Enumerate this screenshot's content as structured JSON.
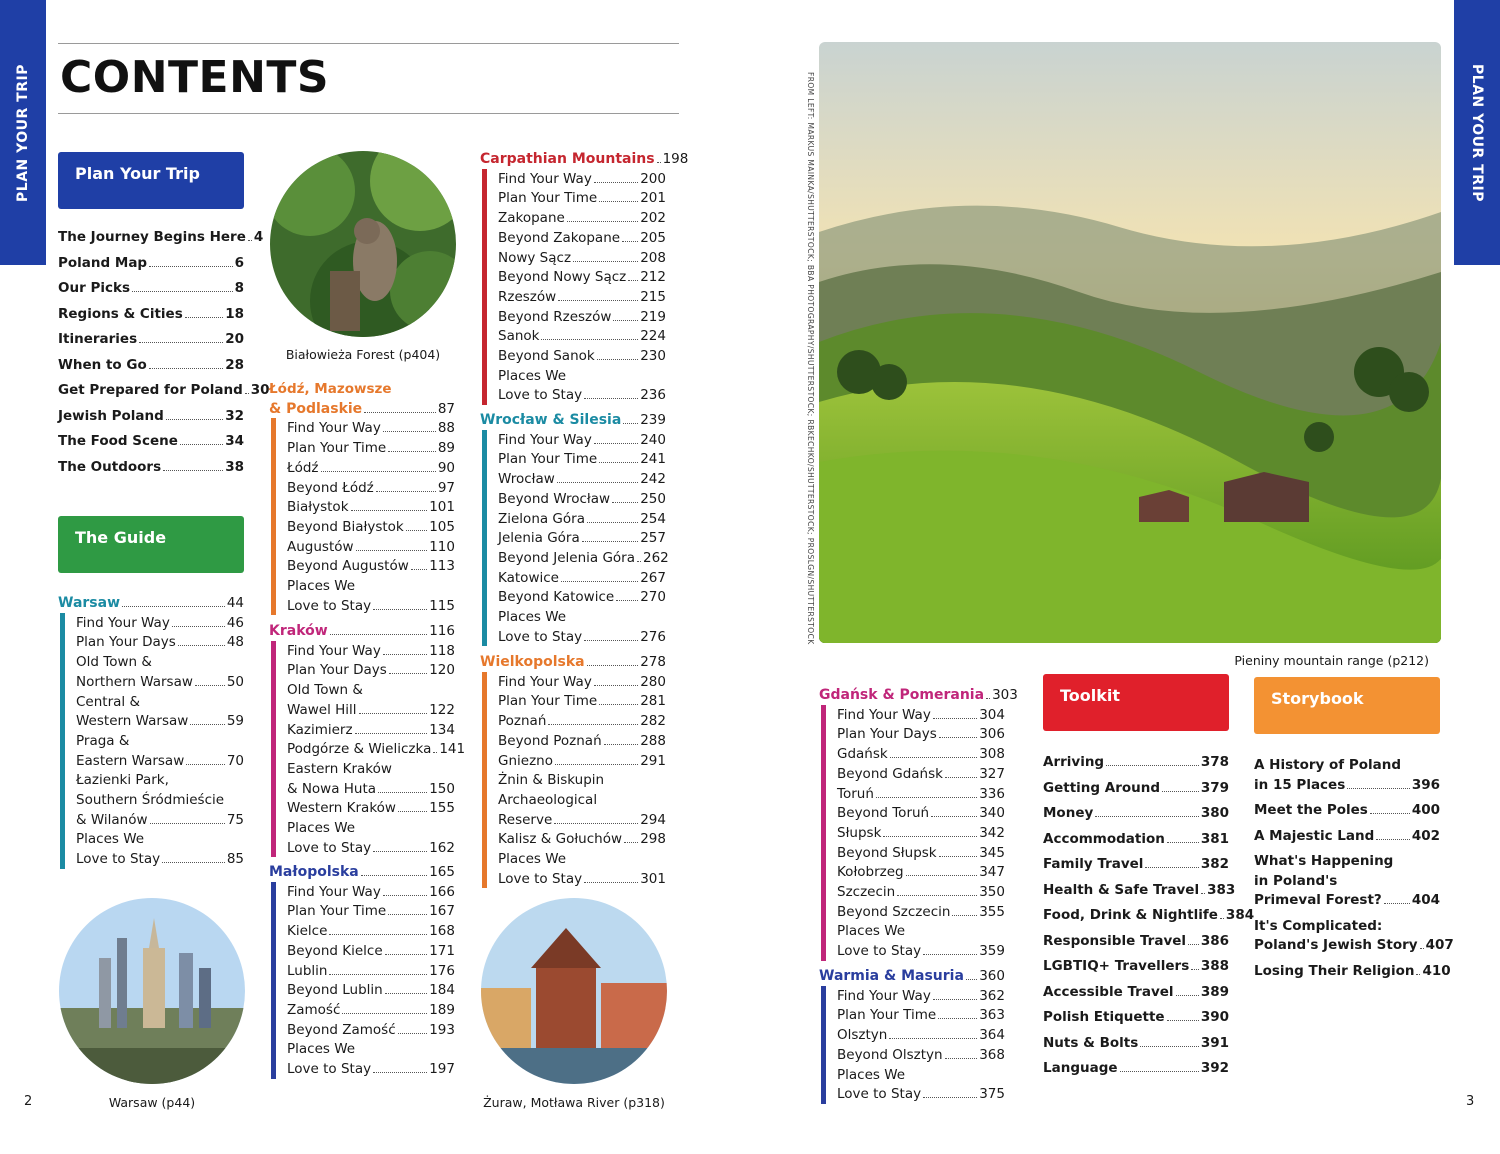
{
  "side_tabs": {
    "left": "PLAN YOUR TRIP",
    "right": "PLAN YOUR TRIP"
  },
  "title": "CONTENTS",
  "boxes": {
    "plan": "Plan Your Trip",
    "guide": "The Guide",
    "toolkit": "Toolkit",
    "storybook": "Storybook"
  },
  "colors": {
    "blue": "#1f3fa6",
    "green": "#2f9a44",
    "red": "#e0202b",
    "orange": "#f39233",
    "warsaw": "#1b8ba3",
    "lodz": "#e6782c",
    "krakow": "#c0267a",
    "malopolska": "#2a3e9e",
    "carpathian": "#c5262f",
    "wroclaw": "#1b8ba3",
    "wielkopolska": "#e6782c",
    "gdansk": "#c0267a",
    "warmia": "#2a3e9e"
  },
  "plan_trip": [
    {
      "t": "The Journey Begins Here",
      "p": "4"
    },
    {
      "t": "Poland Map",
      "p": "6"
    },
    {
      "t": "Our Picks",
      "p": "8"
    },
    {
      "t": "Regions & Cities",
      "p": "18"
    },
    {
      "t": "Itineraries",
      "p": "20"
    },
    {
      "t": "When to Go",
      "p": "28"
    },
    {
      "t": "Get Prepared for Poland",
      "p": "30"
    },
    {
      "t": "Jewish Poland",
      "p": "32"
    },
    {
      "t": "The Food Scene",
      "p": "34"
    },
    {
      "t": "The Outdoors",
      "p": "38"
    }
  ],
  "warsaw": {
    "title": "Warsaw",
    "page": "44",
    "items": [
      {
        "t": "Find Your Way",
        "p": "46"
      },
      {
        "t": "Plan Your Days",
        "p": "48"
      },
      {
        "pre": "Old Town &",
        "t": "Northern Warsaw",
        "p": "50"
      },
      {
        "pre": "Central &",
        "t": "Western Warsaw",
        "p": "59"
      },
      {
        "pre": "Praga &",
        "t": "Eastern Warsaw",
        "p": "70"
      },
      {
        "pre": "Łazienki Park,",
        "pre2": "Southern Śródmieście",
        "t": "& Wilanów",
        "p": "75"
      },
      {
        "pre": "Places We",
        "t": "Love to Stay",
        "p": "85"
      }
    ]
  },
  "lodz": {
    "title1": "Łódź, Mazowsze",
    "title": "& Podlaskie",
    "page": "87",
    "items": [
      {
        "t": "Find Your Way",
        "p": "88"
      },
      {
        "t": "Plan Your Time",
        "p": "89"
      },
      {
        "t": "Łódź",
        "p": "90"
      },
      {
        "t": "Beyond Łódź",
        "p": "97"
      },
      {
        "t": "Białystok",
        "p": "101"
      },
      {
        "t": "Beyond Białystok",
        "p": "105"
      },
      {
        "t": "Augustów",
        "p": "110"
      },
      {
        "t": "Beyond Augustów",
        "p": "113"
      },
      {
        "pre": "Places We",
        "t": "Love to Stay",
        "p": "115"
      }
    ]
  },
  "krakow": {
    "title": "Kraków",
    "page": "116",
    "items": [
      {
        "t": "Find Your Way",
        "p": "118"
      },
      {
        "t": "Plan Your Days",
        "p": "120"
      },
      {
        "pre": "Old Town &",
        "t": "Wawel Hill",
        "p": "122"
      },
      {
        "t": "Kazimierz",
        "p": "134"
      },
      {
        "t": "Podgórze & Wieliczka",
        "p": "141"
      },
      {
        "pre": "Eastern Kraków",
        "t": "& Nowa Huta",
        "p": "150"
      },
      {
        "t": "Western Kraków",
        "p": "155"
      },
      {
        "pre": "Places We",
        "t": "Love to Stay",
        "p": "162"
      }
    ]
  },
  "malopolska": {
    "title": "Małopolska",
    "page": "165",
    "items": [
      {
        "t": "Find Your Way",
        "p": "166"
      },
      {
        "t": "Plan Your Time",
        "p": "167"
      },
      {
        "t": "Kielce",
        "p": "168"
      },
      {
        "t": "Beyond Kielce",
        "p": "171"
      },
      {
        "t": "Lublin",
        "p": "176"
      },
      {
        "t": "Beyond Lublin",
        "p": "184"
      },
      {
        "t": "Zamość",
        "p": "189"
      },
      {
        "t": "Beyond Zamość",
        "p": "193"
      },
      {
        "pre": "Places We",
        "t": "Love to Stay",
        "p": "197"
      }
    ]
  },
  "carpathian": {
    "title": "Carpathian Mountains",
    "page": "198",
    "items": [
      {
        "t": "Find Your Way",
        "p": "200"
      },
      {
        "t": "Plan Your Time",
        "p": "201"
      },
      {
        "t": "Zakopane",
        "p": "202"
      },
      {
        "t": "Beyond Zakopane",
        "p": "205"
      },
      {
        "t": "Nowy Sącz",
        "p": "208"
      },
      {
        "t": "Beyond Nowy Sącz",
        "p": "212"
      },
      {
        "t": "Rzeszów",
        "p": "215"
      },
      {
        "t": "Beyond Rzeszów",
        "p": "219"
      },
      {
        "t": "Sanok",
        "p": "224"
      },
      {
        "t": "Beyond Sanok",
        "p": "230"
      },
      {
        "pre": "Places We",
        "t": "Love to Stay",
        "p": "236"
      }
    ]
  },
  "wroclaw": {
    "title": "Wrocław & Silesia",
    "page": "239",
    "items": [
      {
        "t": "Find Your Way",
        "p": "240"
      },
      {
        "t": "Plan Your Time",
        "p": "241"
      },
      {
        "t": "Wrocław",
        "p": "242"
      },
      {
        "t": "Beyond Wrocław",
        "p": "250"
      },
      {
        "t": "Zielona Góra",
        "p": "254"
      },
      {
        "t": "Jelenia Góra",
        "p": "257"
      },
      {
        "t": "Beyond Jelenia Góra",
        "p": "262"
      },
      {
        "t": "Katowice",
        "p": "267"
      },
      {
        "t": "Beyond Katowice",
        "p": "270"
      },
      {
        "pre": "Places We",
        "t": "Love to Stay",
        "p": "276"
      }
    ]
  },
  "wielkopolska": {
    "title": "Wielkopolska",
    "page": "278",
    "items": [
      {
        "t": "Find Your Way",
        "p": "280"
      },
      {
        "t": "Plan Your Time",
        "p": "281"
      },
      {
        "t": "Poznań",
        "p": "282"
      },
      {
        "t": "Beyond Poznań",
        "p": "288"
      },
      {
        "t": "Gniezno",
        "p": "291"
      },
      {
        "pre": "Żnin & Biskupin",
        "pre2": "Archaeological",
        "t": "Reserve",
        "p": "294"
      },
      {
        "t": "Kalisz & Gołuchów",
        "p": "298"
      },
      {
        "pre": "Places We",
        "t": "Love to Stay",
        "p": "301"
      }
    ]
  },
  "gdansk": {
    "title": "Gdańsk & Pomerania",
    "page": "303",
    "items": [
      {
        "t": "Find Your Way",
        "p": "304"
      },
      {
        "t": "Plan Your Days",
        "p": "306"
      },
      {
        "t": "Gdańsk",
        "p": "308"
      },
      {
        "t": "Beyond Gdańsk",
        "p": "327"
      },
      {
        "t": "Toruń",
        "p": "336"
      },
      {
        "t": "Beyond Toruń",
        "p": "340"
      },
      {
        "t": "Słupsk",
        "p": "342"
      },
      {
        "t": "Beyond Słupsk",
        "p": "345"
      },
      {
        "t": "Kołobrzeg",
        "p": "347"
      },
      {
        "t": "Szczecin",
        "p": "350"
      },
      {
        "t": "Beyond Szczecin",
        "p": "355"
      },
      {
        "pre": "Places We",
        "t": "Love to Stay",
        "p": "359"
      }
    ]
  },
  "warmia": {
    "title": "Warmia & Masuria",
    "page": "360",
    "items": [
      {
        "t": "Find Your Way",
        "p": "362"
      },
      {
        "t": "Plan Your Time",
        "p": "363"
      },
      {
        "t": "Olsztyn",
        "p": "364"
      },
      {
        "t": "Beyond Olsztyn",
        "p": "368"
      },
      {
        "pre": "Places We",
        "t": "Love to Stay",
        "p": "375"
      }
    ]
  },
  "toolkit": [
    {
      "t": "Arriving",
      "p": "378"
    },
    {
      "t": "Getting Around",
      "p": "379"
    },
    {
      "t": "Money",
      "p": "380"
    },
    {
      "t": "Accommodation",
      "p": "381"
    },
    {
      "t": "Family Travel",
      "p": "382"
    },
    {
      "t": "Health & Safe Travel",
      "p": "383"
    },
    {
      "t": "Food, Drink & Nightlife",
      "p": "384"
    },
    {
      "t": "Responsible Travel",
      "p": "386"
    },
    {
      "t": "LGBTIQ+ Travellers",
      "p": "388"
    },
    {
      "t": "Accessible Travel",
      "p": "389"
    },
    {
      "t": "Polish Etiquette",
      "p": "390"
    },
    {
      "t": "Nuts & Bolts",
      "p": "391"
    },
    {
      "t": "Language",
      "p": "392"
    }
  ],
  "storybook": [
    {
      "pre": "A History of Poland",
      "t": "in 15 Places",
      "p": "396"
    },
    {
      "t": "Meet the Poles",
      "p": "400"
    },
    {
      "t": "A Majestic Land",
      "p": "402"
    },
    {
      "pre": "What's Happening",
      "pre2": "in Poland's",
      "t": "Primeval Forest?",
      "p": "404"
    },
    {
      "pre": "It's Complicated:",
      "t": "Poland's Jewish Story",
      "p": "407"
    },
    {
      "t": "Losing Their Religion",
      "p": "410"
    }
  ],
  "captions": {
    "bialowieza": "Białowieża Forest (p404)",
    "warsaw": "Warsaw (p44)",
    "zuraw": "Żuraw, Motława River (p318)",
    "pieniny": "Pieniny mountain range (p212)"
  },
  "photo_credit": "FROM LEFT: MARKUS MAINKA/SHUTTERSTOCK; BBA PHOTOGRAPHY/SHUTTERSTOCK; RBKECHKO/SHUTTERSTOCK; PROSLGN/SHUTTERSTOCK",
  "page_numbers": {
    "left": "2",
    "right": "3"
  }
}
